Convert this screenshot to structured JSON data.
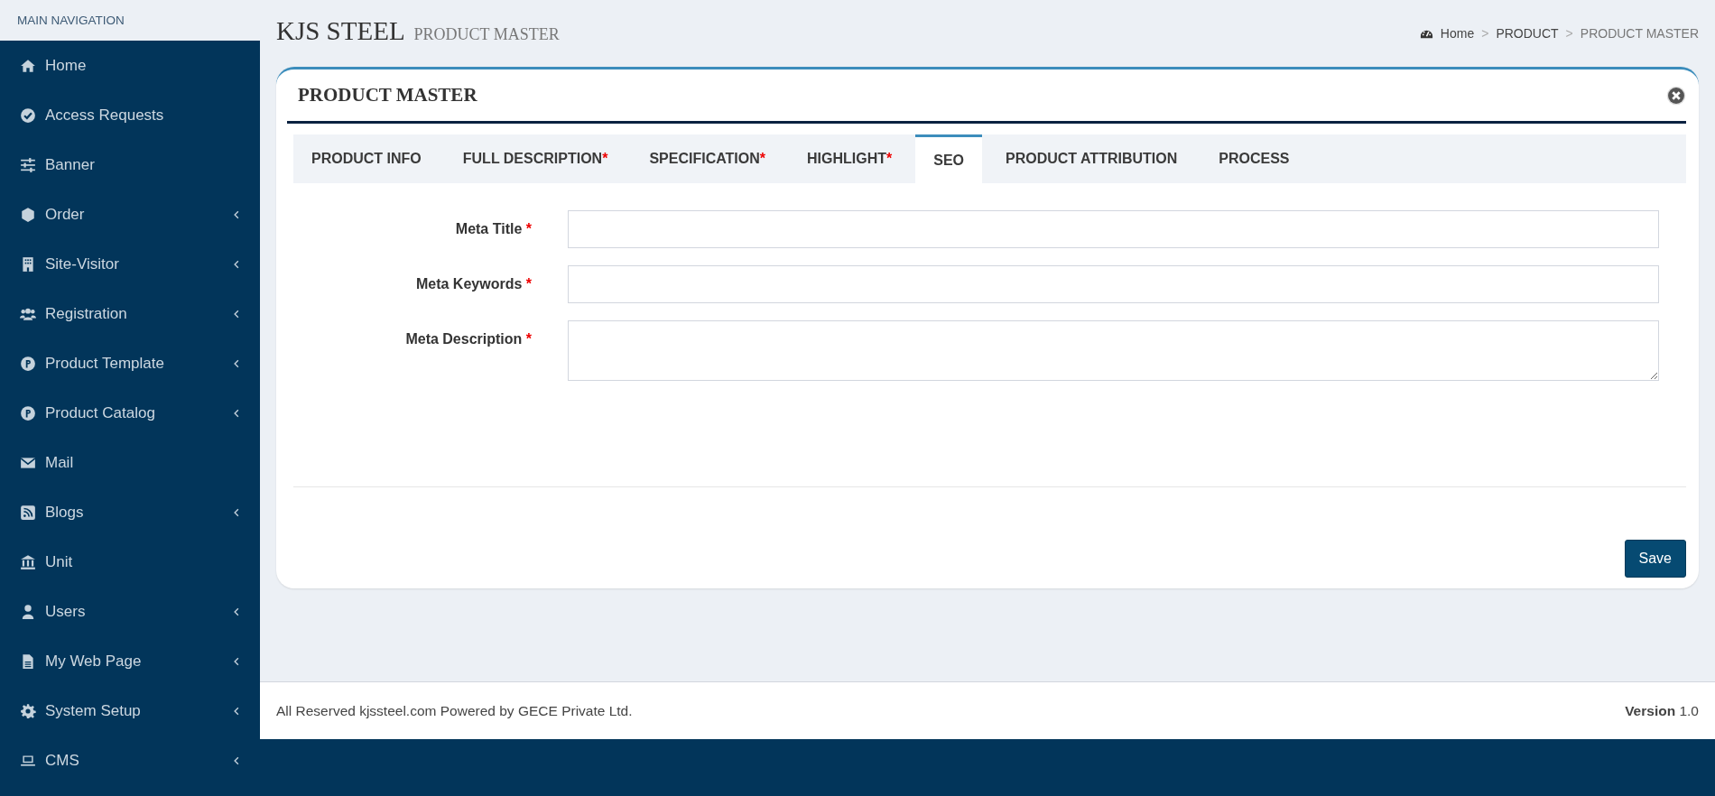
{
  "sidebar": {
    "heading": "MAIN NAVIGATION",
    "items": [
      {
        "label": "Home",
        "submenu": false
      },
      {
        "label": "Access Requests",
        "submenu": false
      },
      {
        "label": "Banner",
        "submenu": false
      },
      {
        "label": "Order",
        "submenu": true
      },
      {
        "label": "Site-Visitor",
        "submenu": true
      },
      {
        "label": "Registration",
        "submenu": true
      },
      {
        "label": "Product Template",
        "submenu": true
      },
      {
        "label": "Product Catalog",
        "submenu": true
      },
      {
        "label": "Mail",
        "submenu": false
      },
      {
        "label": "Blogs",
        "submenu": true
      },
      {
        "label": "Unit",
        "submenu": false
      },
      {
        "label": "Users",
        "submenu": true
      },
      {
        "label": "My Web Page",
        "submenu": true
      },
      {
        "label": "System Setup",
        "submenu": true
      },
      {
        "label": "CMS",
        "submenu": true
      }
    ]
  },
  "header": {
    "title": "KJS STEEL",
    "subtitle": "PRODUCT MASTER",
    "breadcrumb": [
      {
        "label": "Home",
        "current": false
      },
      {
        "separator": ">",
        "label": "PRODUCT",
        "current": false
      },
      {
        "separator": ">",
        "label": "PRODUCT MASTER",
        "current": true
      }
    ]
  },
  "card": {
    "title": "PRODUCT MASTER",
    "tabs": [
      {
        "label": "PRODUCT INFO",
        "selected": false
      },
      {
        "label": "FULL DESCRIPTION",
        "mark": " *",
        "selected": false
      },
      {
        "label": "SPECIFICATION",
        "mark": " *",
        "selected": false
      },
      {
        "label": "HIGHLIGHT",
        "mark": "*",
        "selected": false
      },
      {
        "label": "SEO",
        "selected": true
      },
      {
        "label": "PRODUCT ATTRIBUTION",
        "selected": false
      },
      {
        "label": "PROCESS",
        "selected": false
      }
    ],
    "fields": [
      {
        "kind": "text",
        "label": "Meta Title",
        "mark": "*"
      },
      {
        "kind": "text",
        "label": "Meta Keywords",
        "mark": "*"
      },
      {
        "kind": "textarea",
        "label": "Meta Description",
        "mark": "*"
      }
    ],
    "button": "Save"
  },
  "footer": {
    "text": "All Reserved kjssteel.com Powered by GECE Private Ltd.",
    "version": "**Version** 1.0"
  }
}
